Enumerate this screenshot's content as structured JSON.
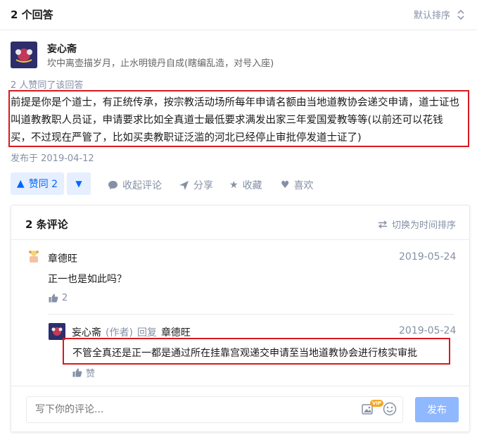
{
  "header": {
    "answer_count": "2 个回答",
    "sort_label": "默认排序"
  },
  "answer": {
    "author_name": "妄心斋",
    "author_bio": "坎中离壶描岁月，止水明镜丹自成(瞎编乱造，对号入座)",
    "voters_text": "2 人赞同了该回答",
    "lines": [
      "前提是你是个道士，有正统传承，按宗教活动场所每年申请名额由当地道教协会递交申请，道士证也",
      "叫道教教职人员证，申请要求比如全真道士最低要求满发出家三年爱国爱教等等(以前还可以花钱",
      "买，不过现在严管了，比如买卖教职证泛滥的河北已经停止审批停发道士证了)"
    ],
    "published": "发布于 2019-04-12"
  },
  "actions": {
    "vote_up_label": "赞同 2",
    "comment_label": "收起评论",
    "share_label": "分享",
    "collect_label": "收藏",
    "like_label": "喜欢"
  },
  "comments": {
    "title": "2 条评论",
    "switch_label": "切换为时间排序",
    "items": [
      {
        "name": "章德旺",
        "date": "2019-05-24",
        "text": "正一也是如此吗？",
        "likes": "2"
      },
      {
        "name": "妄心斋",
        "author_tag": "(作者)",
        "reply_word": "回复",
        "reply_to": "章德旺",
        "date": "2019-05-24",
        "text": "不管全真还是正一都是通过所在挂靠宫观递交申请至当地道教协会进行核实审批",
        "likes": "赞"
      }
    ],
    "input_placeholder": "写下你的评论...",
    "emoji_badge": "VIP",
    "send_label": "发布"
  },
  "colors": {
    "brand_blue": "#0066ff",
    "highlight_red": "#d7191f",
    "meta_gray": "#8590a6"
  }
}
